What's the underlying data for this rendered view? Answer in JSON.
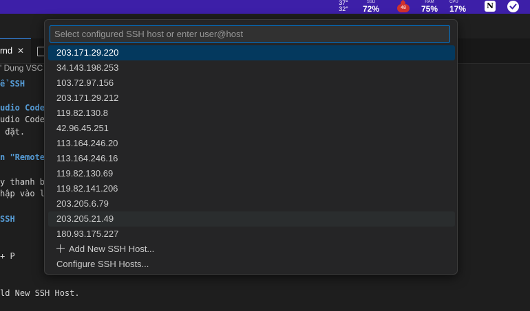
{
  "menubar": {
    "temp_high": "37°",
    "temp_low": "32°",
    "ssd_label": "SSD",
    "ssd_value": "72%",
    "ram_badge": "48",
    "ram_label": "RAM",
    "ram_value": "75%",
    "cpu_label": "CPU",
    "cpu_value": "17%",
    "notion_letter": "N",
    "colors": {
      "bar": "#3d1fa8",
      "badge": "#d0312d"
    }
  },
  "editor": {
    "tab_label": "md",
    "close_glyph": "✕",
    "breadcrumb": "' Dụng VSC",
    "lines": [
      "ể SSH",
      "udio Code",
      "udio Code",
      " đặt.",
      "n \"Remote",
      "y thanh bê",
      "hập vào l",
      "SSH",
      "+ P",
      "ld New SSH Host."
    ]
  },
  "quick_pick": {
    "placeholder": "Select configured SSH host or enter user@host",
    "value": "",
    "hosts": [
      "203.171.29.220",
      "34.143.198.253",
      "103.72.97.156",
      "203.171.29.212",
      "119.82.130.8",
      "42.96.45.251",
      "113.164.246.20",
      "113.164.246.16",
      "119.82.130.69",
      "119.82.141.206",
      "203.205.6.79",
      "203.205.21.49",
      "180.93.175.227"
    ],
    "add_new": "Add New SSH Host...",
    "configure": "Configure SSH Hosts...",
    "selected_index": 0,
    "hovered_index": 11,
    "colors": {
      "selected": "#04395e",
      "focus_border": "#0078d4"
    }
  }
}
